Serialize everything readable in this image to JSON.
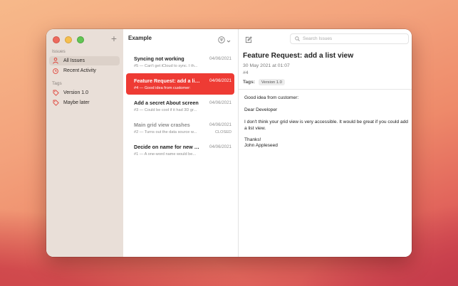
{
  "sidebar": {
    "add_label": "+",
    "sections": {
      "issues": "Issues",
      "tags": "Tags"
    },
    "issues_items": [
      {
        "label": "All Issues",
        "icon": "person-icon",
        "selected": true
      },
      {
        "label": "Recent Activity",
        "icon": "clock-icon",
        "selected": false
      }
    ],
    "tag_items": [
      {
        "label": "Version 1.0",
        "icon": "tag-icon"
      },
      {
        "label": "Maybe later",
        "icon": "tag-icon"
      }
    ]
  },
  "list": {
    "title": "Example",
    "issues": [
      {
        "title": "Syncing not working",
        "date": "04/06/2021",
        "subtitle": "#5 — Can't get iCloud to sync. I th...",
        "status": "",
        "selected": false,
        "closed": false
      },
      {
        "title": "Feature Request: add a list...",
        "date": "04/06/2021",
        "subtitle": "#4 — Good idea from customer:",
        "status": "",
        "selected": true,
        "closed": false
      },
      {
        "title": "Add a secret About screen",
        "date": "04/06/2021",
        "subtitle": "#3 — Could be cool if it had 3D gr...",
        "status": "",
        "selected": false,
        "closed": false
      },
      {
        "title": "Main grid view crashes",
        "date": "04/06/2021",
        "subtitle": "#2 — Turns out the data source w...",
        "status": "CLOSED",
        "selected": false,
        "closed": true
      },
      {
        "title": "Decide on name for new pr...",
        "date": "04/06/2021",
        "subtitle": "#1 — A one-word name would be...",
        "status": "",
        "selected": false,
        "closed": false
      }
    ]
  },
  "detail": {
    "search_placeholder": "Search Issues",
    "title": "Feature Request: add a list view",
    "date": "30 May 2021 at 01:07",
    "number": "#4",
    "tags_label": "Tags:",
    "tags": [
      "Version 1.0"
    ],
    "body": {
      "line1": "Good idea from customer:",
      "line2": "Dear Developer",
      "line3": "I don't think your grid view is very accessible. It would be great if you could add a list view.",
      "line4": "Thanks!",
      "line5": "John Appleseed"
    }
  },
  "colors": {
    "accent": "#ee3b34",
    "sidebar_selected": "#dcd1c9"
  }
}
